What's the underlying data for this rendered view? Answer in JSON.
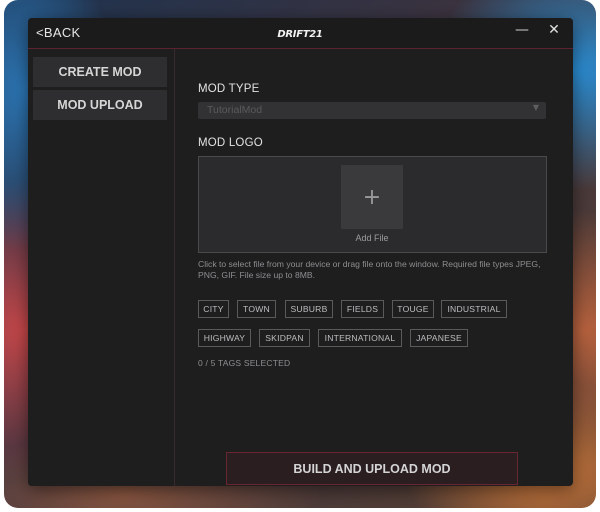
{
  "header": {
    "back_label": "<BACK",
    "logo_text": "DRIFT21",
    "minimize_glyph": "—",
    "close_glyph": "✕"
  },
  "sidebar": {
    "items": [
      {
        "label": "CREATE MOD"
      },
      {
        "label": "MOD UPLOAD"
      }
    ]
  },
  "form": {
    "mod_type_label": "MOD TYPE",
    "mod_type_value": "TutorialMod",
    "mod_logo_label": "MOD LOGO",
    "add_icon": "+",
    "add_file_label": "Add File",
    "help_text": "Click to select file from your device or drag file onto the window. Required file types JPEG, PNG, GIF. File size up to 8MB.",
    "tags": [
      "CITY",
      "TOWN",
      "SUBURB",
      "FIELDS",
      "TOUGE",
      "INDUSTRIAL",
      "HIGHWAY",
      "SKIDPAN",
      "INTERNATIONAL",
      "JAPANESE"
    ],
    "tags_count": "0 / 5 TAGS SELECTED",
    "build_button": "BUILD AND UPLOAD MOD"
  },
  "colors": {
    "accent": "#6a2533",
    "window_bg": "#1e1e1f"
  }
}
